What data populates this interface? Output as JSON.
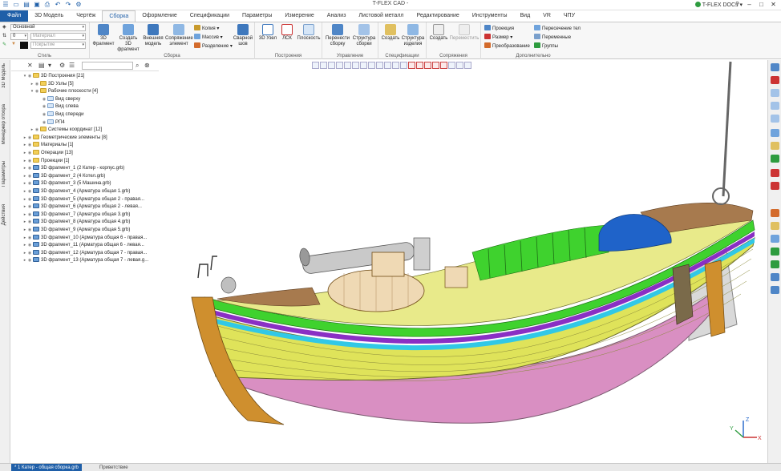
{
  "app": {
    "title": "T-FLEX CAD -",
    "docs_label": "T-FLEX DOCs"
  },
  "tabs": [
    {
      "label": "Файл"
    },
    {
      "label": "3D Модель"
    },
    {
      "label": "Чертёж"
    },
    {
      "label": "Сборка"
    },
    {
      "label": "Оформление"
    },
    {
      "label": "Спецификации"
    },
    {
      "label": "Параметры"
    },
    {
      "label": "Измерение"
    },
    {
      "label": "Анализ"
    },
    {
      "label": "Листовой металл"
    },
    {
      "label": "Редактирование"
    },
    {
      "label": "Инструменты"
    },
    {
      "label": "Вид"
    },
    {
      "label": "VR"
    },
    {
      "label": "ЧПУ"
    }
  ],
  "ribbon": {
    "style": {
      "name": "Стиль",
      "layer_value": "Основной",
      "priority_value": "0",
      "material_placeholder": "Материал",
      "coating_placeholder": "Покрытие"
    },
    "assembly": {
      "name": "Сборка",
      "fragment_3d": "3D Фрагмент",
      "create_fragment": "Создать 3D фрагмент",
      "external_model": "Внешняя модель",
      "mating_element": "Сопряжение элемент",
      "copy": "Копия",
      "array": "Массив",
      "split": "Разделение",
      "weld": "Сварной шов"
    },
    "constructions": {
      "name": "Построения",
      "node_3d": "3D Узел",
      "lcs": "ЛСК",
      "plane": "Плоскость"
    },
    "management": {
      "name": "Управление",
      "rebuild": "Перенести сборку",
      "structure": "Структура сборки"
    },
    "specifications": {
      "name": "Спецификации",
      "create": "Создать",
      "product_structure": "Структура изделия"
    },
    "mates": {
      "name": "Сопряжения",
      "create": "Создать",
      "move": "Переместить"
    },
    "additional": {
      "name": "Дополнительно",
      "projection": "Проекция",
      "size": "Размер",
      "transform": "Преобразование",
      "intersection": "Пересечение тел",
      "variables": "Переменные",
      "groups": "Группы"
    }
  },
  "side_panels": [
    "3D Модель",
    "Менеджер отбора",
    "Параметры",
    "Действия"
  ],
  "tree": {
    "items": [
      {
        "label": "3D Построения [21]",
        "level": 1,
        "icon": "folder",
        "expanded": true
      },
      {
        "label": "3D Узлы [5]",
        "level": 2,
        "icon": "folder",
        "expanded": false
      },
      {
        "label": "Рабочие плоскости [4]",
        "level": 2,
        "icon": "folder",
        "expanded": true
      },
      {
        "label": "Вид сверху",
        "level": 3,
        "icon": "plane"
      },
      {
        "label": "Вид слева",
        "level": 3,
        "icon": "plane"
      },
      {
        "label": "Вид спереди",
        "level": 3,
        "icon": "plane"
      },
      {
        "label": "РП4",
        "level": 3,
        "icon": "plane"
      },
      {
        "label": "Системы координат [12]",
        "level": 2,
        "icon": "folder",
        "expanded": false
      },
      {
        "label": "Геометрические элементы [8]",
        "level": 1,
        "icon": "folder"
      },
      {
        "label": "Материалы [1]",
        "level": 1,
        "icon": "folder"
      },
      {
        "label": "Операции [13]",
        "level": 1,
        "icon": "folder"
      },
      {
        "label": "Проекции [1]",
        "level": 1,
        "icon": "folder"
      },
      {
        "label": "3D фрагмент_1 (2 Катер - корпус.grb)",
        "level": 1,
        "icon": "frag"
      },
      {
        "label": "3D фрагмент_2 (4 Котел.grb)",
        "level": 1,
        "icon": "frag"
      },
      {
        "label": "3D фрагмент_3 (5 Машина.grb)",
        "level": 1,
        "icon": "frag"
      },
      {
        "label": "3D фрагмент_4 (Арматура общая 1.grb)",
        "level": 1,
        "icon": "frag"
      },
      {
        "label": "3D фрагмент_5 (Арматура общая 2 - правая...",
        "level": 1,
        "icon": "frag"
      },
      {
        "label": "3D фрагмент_6 (Арматура общая 2 - левая...",
        "level": 1,
        "icon": "frag"
      },
      {
        "label": "3D фрагмент_7 (Арматура общая 3.grb)",
        "level": 1,
        "icon": "frag"
      },
      {
        "label": "3D фрагмент_8 (Арматура общая 4.grb)",
        "level": 1,
        "icon": "frag"
      },
      {
        "label": "3D фрагмент_9 (Арматура общая 5.grb)",
        "level": 1,
        "icon": "frag"
      },
      {
        "label": "3D фрагмент_10 (Арматура общая 6 - правая...",
        "level": 1,
        "icon": "frag"
      },
      {
        "label": "3D фрагмент_11 (Арматура общая 6 - левая...",
        "level": 1,
        "icon": "frag"
      },
      {
        "label": "3D фрагмент_12 (Арматура общая 7 - правая...",
        "level": 1,
        "icon": "frag"
      },
      {
        "label": "3D фрагмент_13 (Арматура общая 7 - левая.g...",
        "level": 1,
        "icon": "frag"
      }
    ]
  },
  "axes": {
    "x": "X",
    "y": "Y",
    "z": "Z"
  },
  "doc_tabs": [
    {
      "label": "* 1 Катер - общая сборка.grb",
      "active": true
    },
    {
      "label": "Приветствие",
      "active": false
    }
  ],
  "colors": {
    "accent": "#1f5fa8",
    "hull_yellow": "#dfe35a",
    "hull_pink": "#d98fc2",
    "deck_green": "#3fd22e",
    "stripe_purple": "#8a2fc4",
    "stripe_cyan": "#31c8e6",
    "keel_orange": "#cf8f2e",
    "tarp_blue": "#1f63c9",
    "deck_wood": "#a77a4e"
  }
}
